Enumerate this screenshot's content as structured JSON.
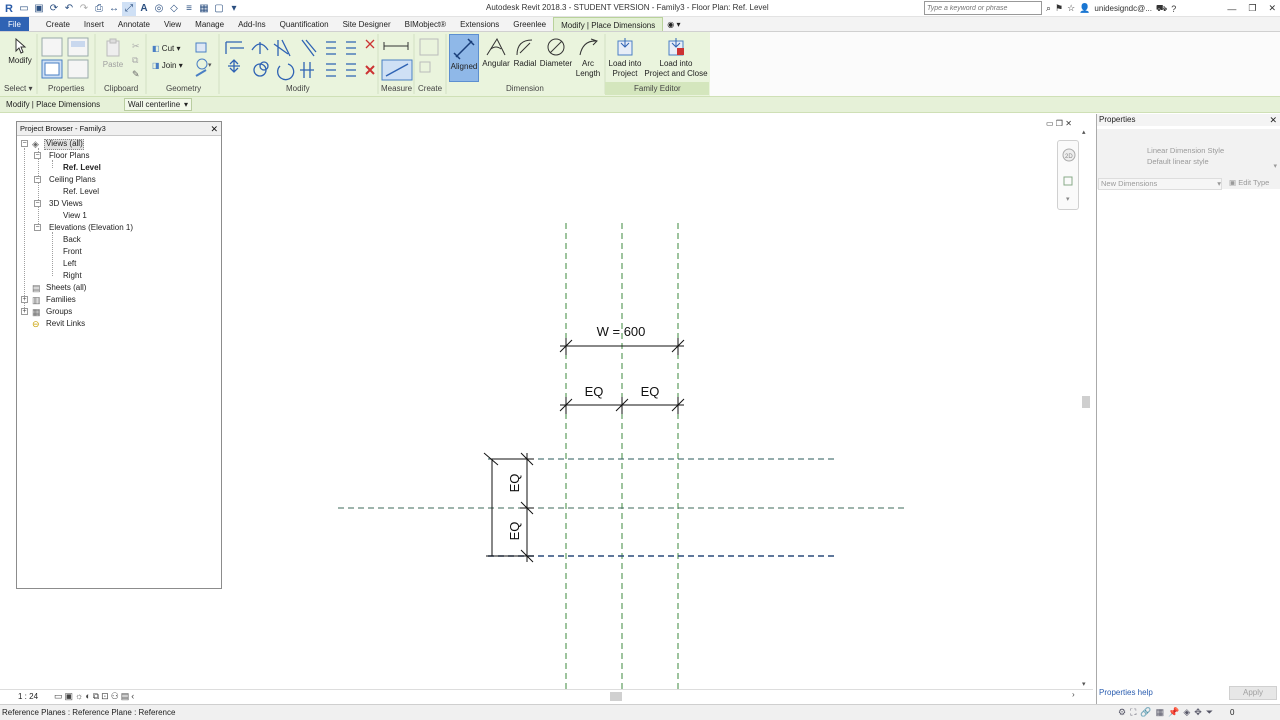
{
  "window": {
    "title": "Autodesk Revit 2018.3 - STUDENT VERSION -    Family3 - Floor Plan: Ref. Level",
    "search_placeholder": "Type a keyword or phrase",
    "user": "unidesigndc@..."
  },
  "tabs": [
    {
      "label": "File"
    },
    {
      "label": "Create"
    },
    {
      "label": "Insert"
    },
    {
      "label": "Annotate"
    },
    {
      "label": "View"
    },
    {
      "label": "Manage"
    },
    {
      "label": "Add-Ins"
    },
    {
      "label": "Quantification"
    },
    {
      "label": "Site Designer"
    },
    {
      "label": "BIMobject®"
    },
    {
      "label": "Extensions"
    },
    {
      "label": "Greenlee"
    },
    {
      "label": "Modify | Place Dimensions"
    }
  ],
  "ribbon": {
    "panels": {
      "select": "Select",
      "properties": "Properties",
      "clipboard": "Clipboard",
      "geometry": "Geometry",
      "modify": "Modify",
      "measure": "Measure",
      "create": "Create",
      "dimension": "Dimension",
      "family_editor": "Family Editor"
    },
    "modify_label": "Modify",
    "paste_label": "Paste",
    "cut_label": "Cut",
    "join_label": "Join",
    "aligned_label": "Aligned",
    "angular_label": "Angular",
    "radial_label": "Radial",
    "diameter_label": "Diameter",
    "arc_length_label_1": "Arc",
    "arc_length_label_2": "Length",
    "load_project_1": "Load into",
    "load_project_2": "Project",
    "load_close_1": "Load into",
    "load_close_2": "Project and Close"
  },
  "options_bar": {
    "context": "Modify | Place Dimensions",
    "pick_value": "Wall centerline"
  },
  "project_browser": {
    "title": "Project Browser - Family3",
    "items": [
      {
        "label": "Views (all)"
      },
      {
        "label": "Floor Plans"
      },
      {
        "label": "Ref. Level"
      },
      {
        "label": "Ceiling Plans"
      },
      {
        "label": "Ref. Level"
      },
      {
        "label": "3D Views"
      },
      {
        "label": "View 1"
      },
      {
        "label": "Elevations (Elevation 1)"
      },
      {
        "label": "Back"
      },
      {
        "label": "Front"
      },
      {
        "label": "Left"
      },
      {
        "label": "Right"
      },
      {
        "label": "Sheets (all)"
      },
      {
        "label": "Families"
      },
      {
        "label": "Groups"
      },
      {
        "label": "Revit Links"
      }
    ]
  },
  "drawing": {
    "width_dim": "W = 600",
    "eq": "EQ"
  },
  "properties": {
    "title": "Properties",
    "type_name_1": "Linear Dimension Style",
    "type_name_2": "Default linear style",
    "new_dimensions": "New Dimensions",
    "edit_type": "Edit Type",
    "help": "Properties help",
    "apply": "Apply"
  },
  "view_bar": {
    "scale": "1 : 24"
  },
  "status": {
    "message": "Reference Planes : Reference Plane : Reference",
    "filter_count": "0"
  },
  "colors": {
    "file_tab": "#2f63b4",
    "context_tab": "#e3f0d4",
    "ref_plane_green": "#3c8a3c",
    "ref_plane_blue": "#2a4a7a",
    "selected": "#8fb8e8"
  }
}
